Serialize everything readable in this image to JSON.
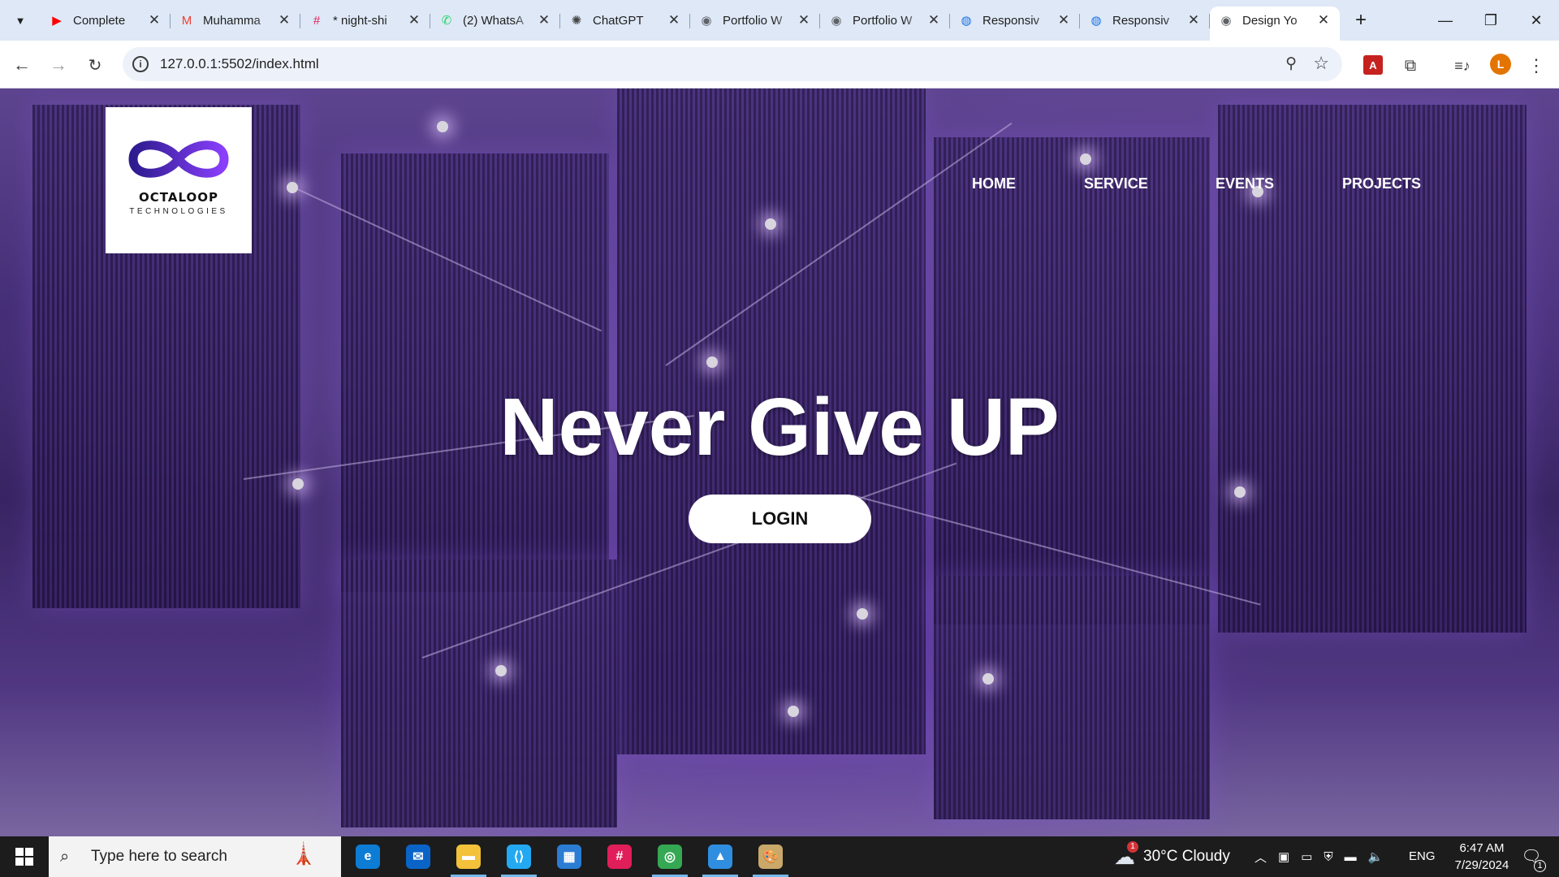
{
  "browser": {
    "tabs": [
      {
        "title": "Complete",
        "icon": "youtube-icon",
        "color": "#ff0000"
      },
      {
        "title": "Muhamma",
        "icon": "gmail-icon",
        "color": "#ea4335"
      },
      {
        "title": "* night-shi",
        "icon": "slack-icon",
        "color": "#e01e5a"
      },
      {
        "title": "(2) WhatsA",
        "icon": "whatsapp-icon",
        "color": "#25d366"
      },
      {
        "title": "ChatGPT",
        "icon": "chatgpt-icon",
        "color": "#444444"
      },
      {
        "title": "Portfolio W",
        "icon": "globe-icon",
        "color": "#5f6368"
      },
      {
        "title": "Portfolio W",
        "icon": "globe-icon",
        "color": "#5f6368"
      },
      {
        "title": "Responsiv",
        "icon": "codepen-icon",
        "color": "#1a73e8"
      },
      {
        "title": "Responsiv",
        "icon": "codepen-icon",
        "color": "#1a73e8"
      },
      {
        "title": "Design Yo",
        "icon": "globe-icon",
        "color": "#5f6368",
        "active": true
      }
    ],
    "url": "127.0.0.1:5502/index.html",
    "profile_initial": "L"
  },
  "site": {
    "logo": {
      "name": "OCTALOOP",
      "sub": "TECHNOLOGIES",
      "colors": [
        "#2d1b8f",
        "#8a3ffc"
      ]
    },
    "nav": [
      "HOME",
      "SERVICE",
      "EVENTS",
      "PROJECTS"
    ],
    "hero_title": "Never Give UP",
    "login_label": "LOGIN"
  },
  "taskbar": {
    "search_placeholder": "Type here to search",
    "pinned": [
      "edge-icon",
      "mail-icon",
      "file-explorer-icon",
      "vscode-icon",
      "store-icon",
      "slack-icon",
      "chrome-icon",
      "photos-icon",
      "paint-icon"
    ],
    "weather": {
      "temp": "30°C",
      "condition": "Cloudy",
      "badge": "1"
    },
    "language": "ENG",
    "time": "6:47 AM",
    "date": "7/29/2024",
    "notification_count": "1"
  }
}
